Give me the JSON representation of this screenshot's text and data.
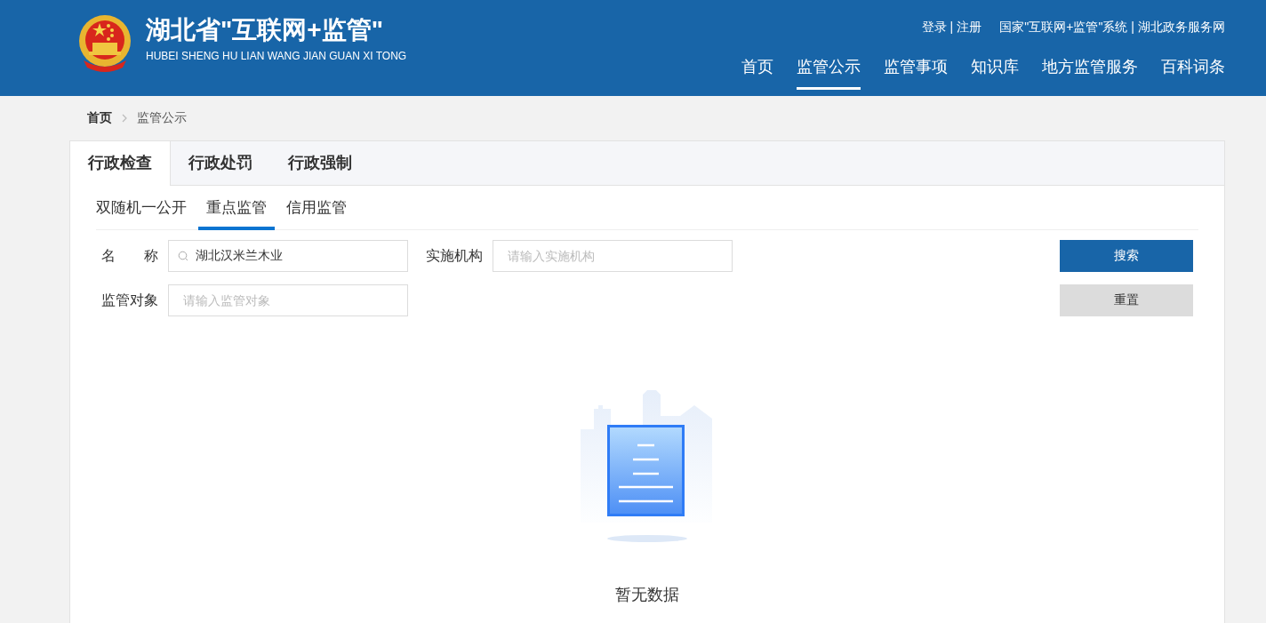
{
  "header": {
    "title": "湖北省\"互联网+监管\"",
    "subtitle": "HUBEI SHENG HU LIAN WANG JIAN GUAN XI TONG",
    "separator": "|",
    "top_link_groups": [
      [
        "登录",
        "注册"
      ],
      [
        "国家\"互联网+监管\"系统",
        "湖北政务服务网"
      ]
    ],
    "nav": [
      {
        "label": "首页",
        "selected": false
      },
      {
        "label": "监管公示",
        "selected": true
      },
      {
        "label": "监管事项",
        "selected": false
      },
      {
        "label": "知识库",
        "selected": false
      },
      {
        "label": "地方监管服务",
        "selected": false
      },
      {
        "label": "百科词条",
        "selected": false
      }
    ]
  },
  "breadcrumb": [
    "首页",
    "监管公示"
  ],
  "panel": {
    "tabs": [
      {
        "label": "行政检查",
        "selected": true
      },
      {
        "label": "行政处罚",
        "selected": false
      },
      {
        "label": "行政强制",
        "selected": false
      }
    ],
    "subtabs": [
      {
        "label": "双随机一公开",
        "selected": false
      },
      {
        "label": "重点监管",
        "selected": true
      },
      {
        "label": "信用监管",
        "selected": false
      }
    ],
    "fields": [
      {
        "label": "名　　称",
        "kind": "search",
        "value": "湖北汉米兰木业"
      },
      {
        "label": "实施机构",
        "kind": "text",
        "placeholder": "请输入实施机构"
      },
      {
        "label": "监管对象",
        "kind": "text",
        "placeholder": "请输入监管对象"
      }
    ],
    "buttons": [
      {
        "label": "搜索",
        "kind": "primary"
      },
      {
        "label": "重置",
        "kind": "secondary"
      }
    ],
    "empty_message": "暂无数据"
  }
}
